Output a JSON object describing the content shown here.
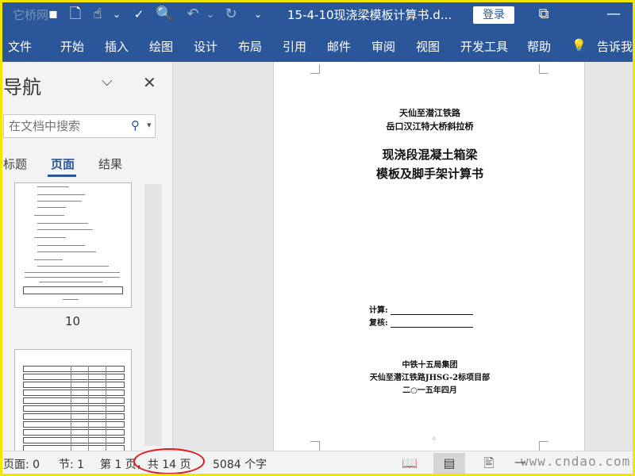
{
  "titlebar": {
    "ghost_text": "它桥网",
    "doc_title": "15-4-10现浇梁模板计算书.d...",
    "login_label": "登录",
    "icons": [
      "save-icon",
      "new-doc-icon",
      "touch-mode-icon",
      "spelling-icon",
      "print-preview-icon",
      "undo-icon",
      "redo-icon",
      "customize-qa-icon",
      "ribbon-display-icon"
    ]
  },
  "ribbon": {
    "tabs": [
      "文件",
      "开始",
      "插入",
      "绘图",
      "设计",
      "布局",
      "引用",
      "邮件",
      "审阅",
      "视图",
      "开发工具",
      "帮助",
      "告诉我"
    ]
  },
  "nav": {
    "title": "导航",
    "search_placeholder": "在文档中搜索",
    "tabs": [
      "标题",
      "页面",
      "结果"
    ],
    "active_tab": "页面",
    "thumb_label": "10"
  },
  "document": {
    "line1": "天仙至潜江铁路",
    "line2": "岳口汉江特大桥斜拉桥",
    "title1": "现浇段混凝土箱梁",
    "title2": "模板及脚手架计算书",
    "calc_label": "计算:",
    "review_label": "复核:",
    "org1": "中铁十五局集团",
    "org2": "天仙至潜江铁路JHSG-2标项目部",
    "date": "二○一五年四月",
    "page_no": "0"
  },
  "statusbar": {
    "page": "页面: 0",
    "section": "节: 1",
    "page_of": "第 1 页，共 14 页",
    "words": "5084 个字",
    "watermark": "www.cndao.com"
  },
  "colors": {
    "brand": "#2b579a",
    "annotation": "#e0191f",
    "frame": "#f2e600"
  }
}
